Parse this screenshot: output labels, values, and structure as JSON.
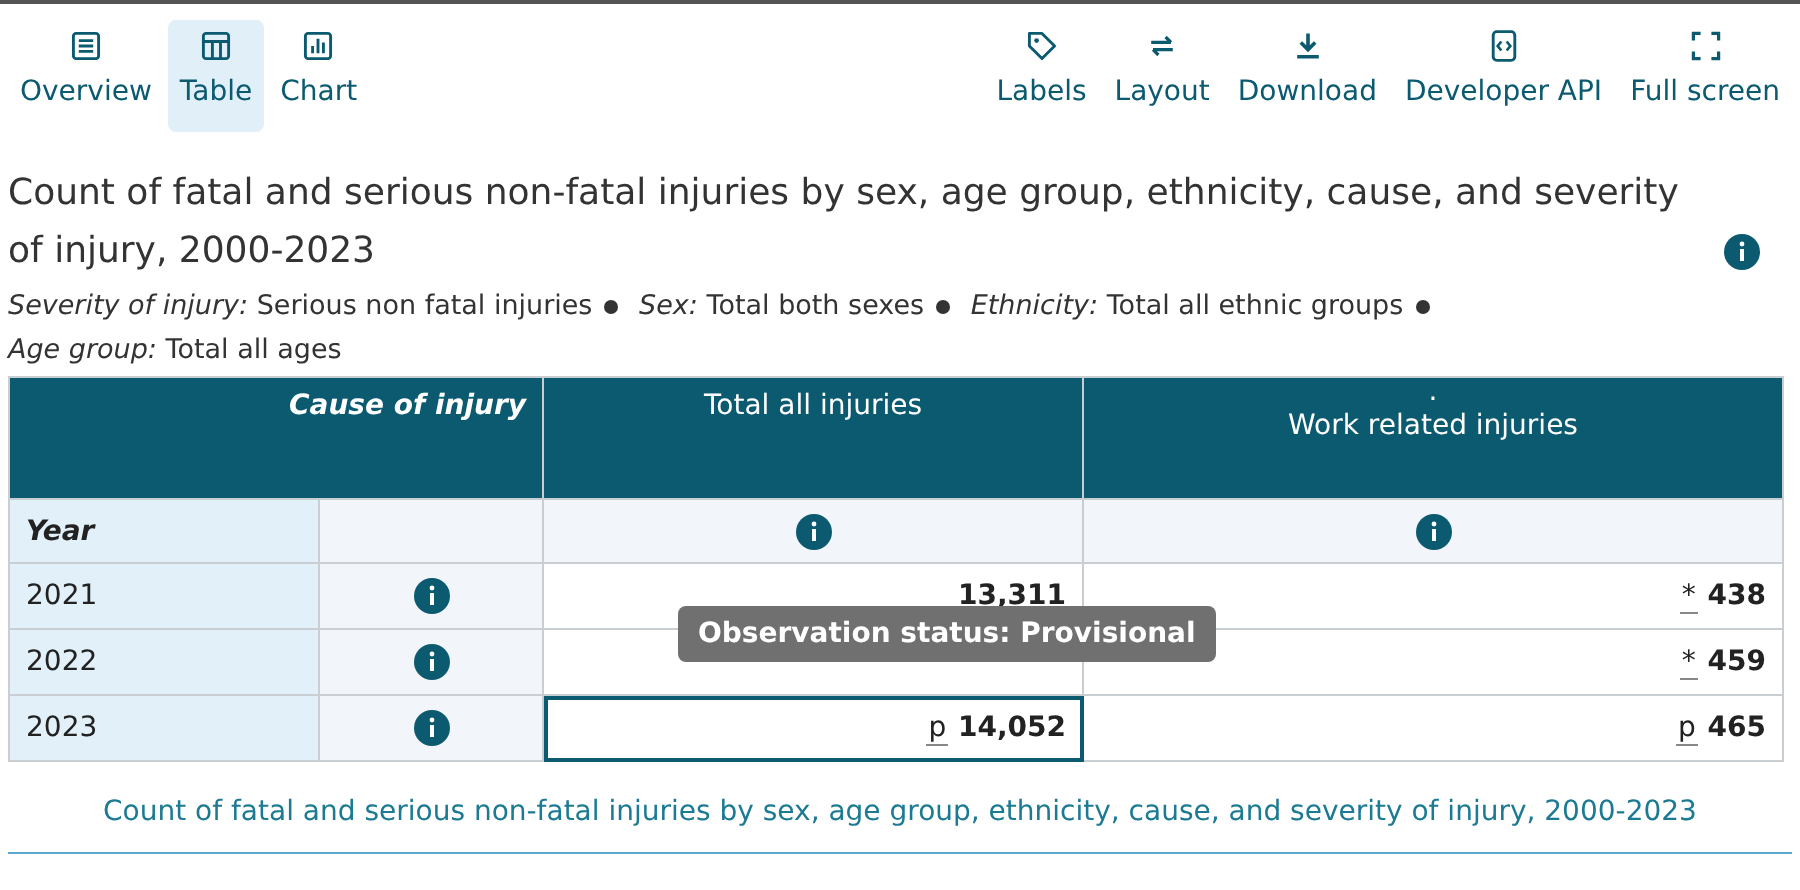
{
  "toolbar": {
    "views": [
      {
        "label": "Overview",
        "selected": false
      },
      {
        "label": "Table",
        "selected": true
      },
      {
        "label": "Chart",
        "selected": false
      }
    ],
    "actions": [
      {
        "label": "Labels"
      },
      {
        "label": "Layout"
      },
      {
        "label": "Download"
      },
      {
        "label": "Developer API"
      },
      {
        "label": "Full screen"
      }
    ]
  },
  "heading": {
    "title": "Count of fatal and serious non-fatal injuries by sex, age group, ethnicity, cause, and severity of injury, 2000-2023",
    "filters": [
      {
        "name": "Severity of injury:",
        "value": "Serious non fatal injuries"
      },
      {
        "name": "Sex:",
        "value": "Total both sexes"
      },
      {
        "name": "Ethnicity:",
        "value": "Total all ethnic groups"
      },
      {
        "name": "Age group:",
        "value": "Total all ages"
      }
    ]
  },
  "table": {
    "corner": "Cause of injury",
    "row_header": "Year",
    "columns": [
      {
        "label": "Total all injuries"
      },
      {
        "note": "·",
        "label": "Work related injuries"
      }
    ],
    "rows": [
      {
        "year": "2021",
        "cells": [
          {
            "value": "13,311",
            "focused": false
          },
          {
            "marker": "*",
            "value": "438",
            "focused": false
          }
        ]
      },
      {
        "year": "2022",
        "cells": [
          {
            "focused": false
          },
          {
            "marker": "*",
            "value": "459",
            "focused": false
          }
        ]
      },
      {
        "year": "2023",
        "cells": [
          {
            "marker": "p",
            "value": "14,052",
            "focused": true
          },
          {
            "marker": "p",
            "value": "465",
            "focused": false
          }
        ]
      }
    ],
    "tooltip": {
      "text": "Observation status: Provisional"
    }
  },
  "caption": "Count of fatal and serious non-fatal injuries by sex, age group, ethnicity, cause, and severity of injury, 2000-2023"
}
